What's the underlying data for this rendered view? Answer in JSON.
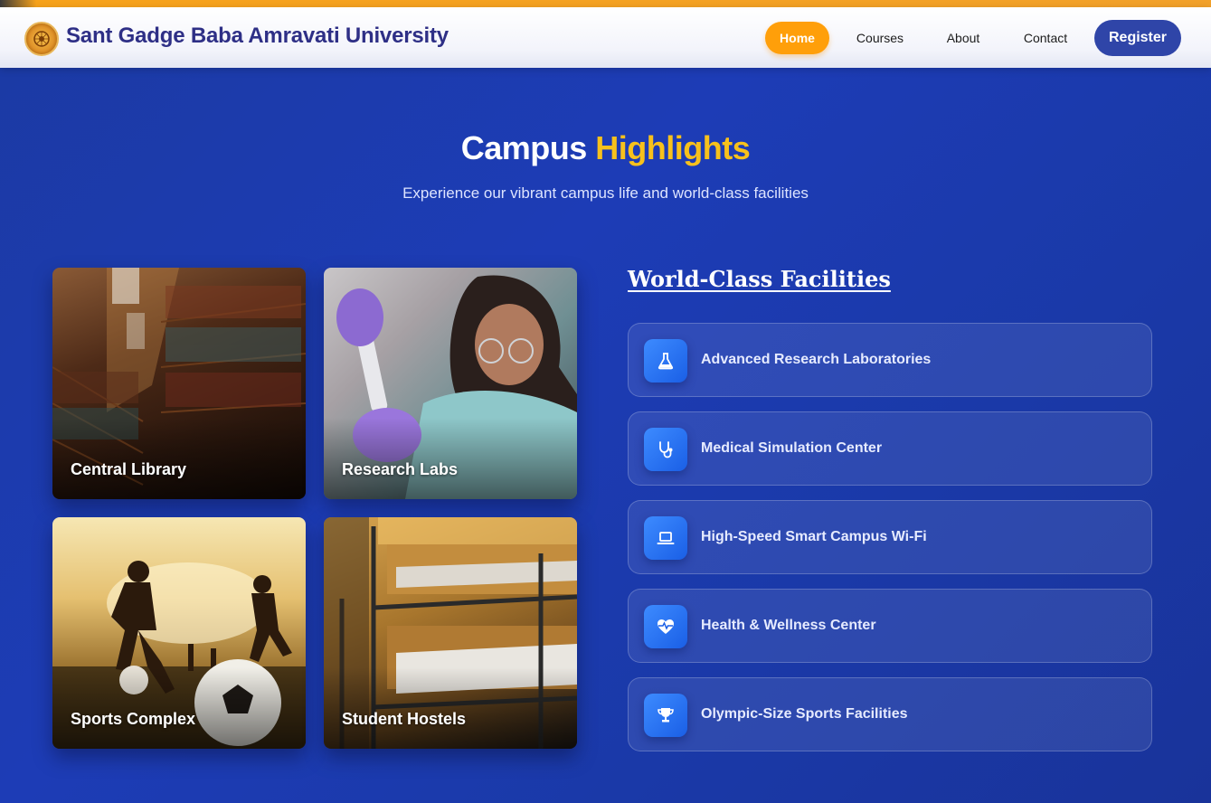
{
  "header": {
    "brand": "Sant Gadge Baba Amravati University",
    "nav": {
      "home": "Home",
      "courses": "Courses",
      "about": "About",
      "contact": "Contact",
      "register": "Register"
    }
  },
  "section": {
    "title_main": "Campus",
    "title_highlight": "Highlights",
    "subtitle": "Experience our vibrant campus life and world-class facilities"
  },
  "cards": [
    {
      "label": "Central Library"
    },
    {
      "label": "Research Labs"
    },
    {
      "label": "Sports Complex"
    },
    {
      "label": "Student Hostels"
    }
  ],
  "facilities": {
    "title": "World-Class Facilities",
    "items": [
      {
        "label": "Advanced Research Laboratories",
        "icon": "flask-icon"
      },
      {
        "label": "Medical Simulation Center",
        "icon": "stethoscope-icon"
      },
      {
        "label": "High-Speed Smart Campus Wi-Fi",
        "icon": "laptop-icon"
      },
      {
        "label": "Health & Wellness Center",
        "icon": "heart-pulse-icon"
      },
      {
        "label": "Olympic-Size Sports Facilities",
        "icon": "trophy-icon"
      }
    ]
  },
  "colors": {
    "accent": "#ff9f0a",
    "highlight": "#f7c11c",
    "primary": "#2f45a8",
    "background": "#1d3cb6"
  }
}
